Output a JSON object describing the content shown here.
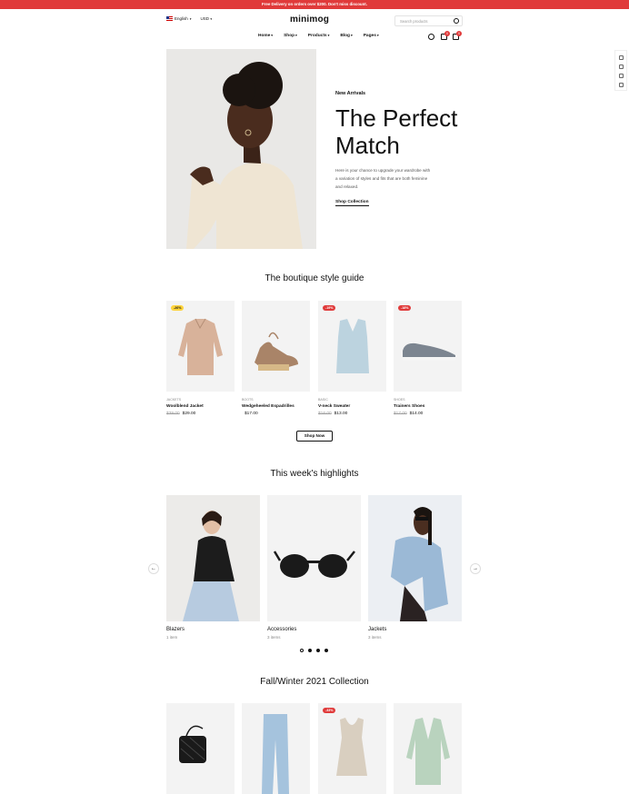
{
  "announcement": "Free Delivery on orders over $200. Don't miss discount.",
  "header": {
    "language": "English",
    "currency": "USD",
    "logo": "minimog",
    "search_placeholder": "Search products",
    "nav": [
      "Home",
      "Shop",
      "Products",
      "Blog",
      "Pages"
    ],
    "wishlist_count": "0",
    "cart_count": "0"
  },
  "hero": {
    "eyebrow": "New Arrivals",
    "title_line1": "The Perfect",
    "title_line2": "Match",
    "description": "Here is your chance to upgrade your wardrobe with a variation of styles and fits that are both feminine and relaxed.",
    "cta": "Shop Collection"
  },
  "style_guide": {
    "title": "The boutique style guide",
    "products": [
      {
        "badge": "-26%",
        "category": "JACKETS",
        "name": "Woolblend Jacket",
        "old_price": "$39.00",
        "price": "$29.00"
      },
      {
        "badge": "",
        "category": "BOOTS",
        "name": "Wedgeheeled Espadrilles",
        "old_price": "",
        "price": "$17.00"
      },
      {
        "badge": "-19%",
        "category": "BASIC",
        "name": "V-neck Sweater",
        "old_price": "$16.00",
        "price": "$13.00"
      },
      {
        "badge": "-18%",
        "category": "SHOES",
        "name": "Trainers Shoes",
        "old_price": "$17.00",
        "price": "$14.00"
      }
    ],
    "cta": "Shop Now"
  },
  "highlights": {
    "title": "This week's highlights",
    "items": [
      {
        "name": "Blazers",
        "count": "1 item"
      },
      {
        "name": "Accessories",
        "count": "3 items"
      },
      {
        "name": "Jackets",
        "count": "3 items"
      }
    ]
  },
  "collection": {
    "title": "Fall/Winter 2021 Collection",
    "badge": "-33%"
  },
  "colors": {
    "accent": "#e03a3a",
    "sale_yellow": "#ffd43b",
    "card_bg": "#f3f3f3"
  }
}
